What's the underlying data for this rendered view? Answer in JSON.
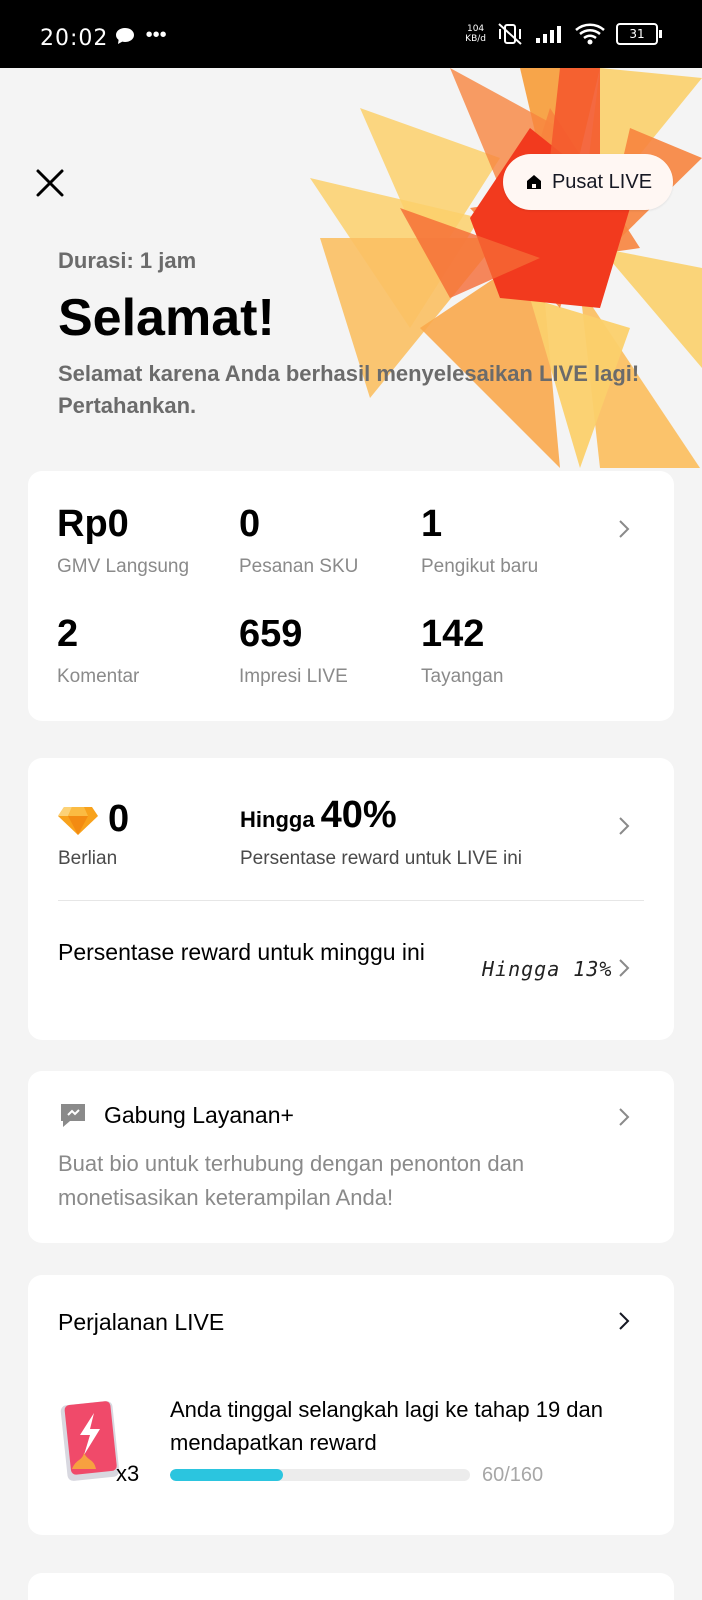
{
  "status_bar": {
    "time": "20:02",
    "net_speed_top": "104",
    "net_speed_bottom": "KB/d",
    "battery": "31"
  },
  "header": {
    "pusat_live_label": "Pusat LIVE",
    "duration": "Durasi: 1 jam",
    "title": "Selamat!",
    "subtitle": "Selamat karena Anda berhasil menyelesaikan LIVE lagi! Pertahankan."
  },
  "stats": [
    {
      "value": "Rp0",
      "label": "GMV Langsung"
    },
    {
      "value": "0",
      "label": "Pesanan SKU"
    },
    {
      "value": "1",
      "label": "Pengikut baru"
    },
    {
      "value": "2",
      "label": "Komentar"
    },
    {
      "value": "659",
      "label": "Impresi LIVE"
    },
    {
      "value": "142",
      "label": "Tayangan"
    }
  ],
  "rewards": {
    "diamond_value": "0",
    "diamond_label": "Berlian",
    "up_to_prefix": "Hingga",
    "up_to_percent": "40%",
    "reward_label": "Persentase reward untuk LIVE ini",
    "weekly_label": "Persentase reward untuk minggu ini",
    "weekly_value": "Hingga 13%"
  },
  "layanan": {
    "title": "Gabung Layanan+",
    "description": "Buat bio untuk terhubung dengan penonton dan monetisasikan keterampilan Anda!"
  },
  "journey": {
    "title": "Perjalanan LIVE",
    "multiplier": "x3",
    "message": "Anda tinggal selangkah lagi ke tahap 19 dan mendapatkan reward",
    "progress_current": 60,
    "progress_total": 160,
    "progress_text": "60/160"
  },
  "colors": {
    "progress": "#2bc5df",
    "burst_dark": "#f23a1e",
    "burst_mid": "#f7843e",
    "burst_light": "#fbd06b"
  }
}
